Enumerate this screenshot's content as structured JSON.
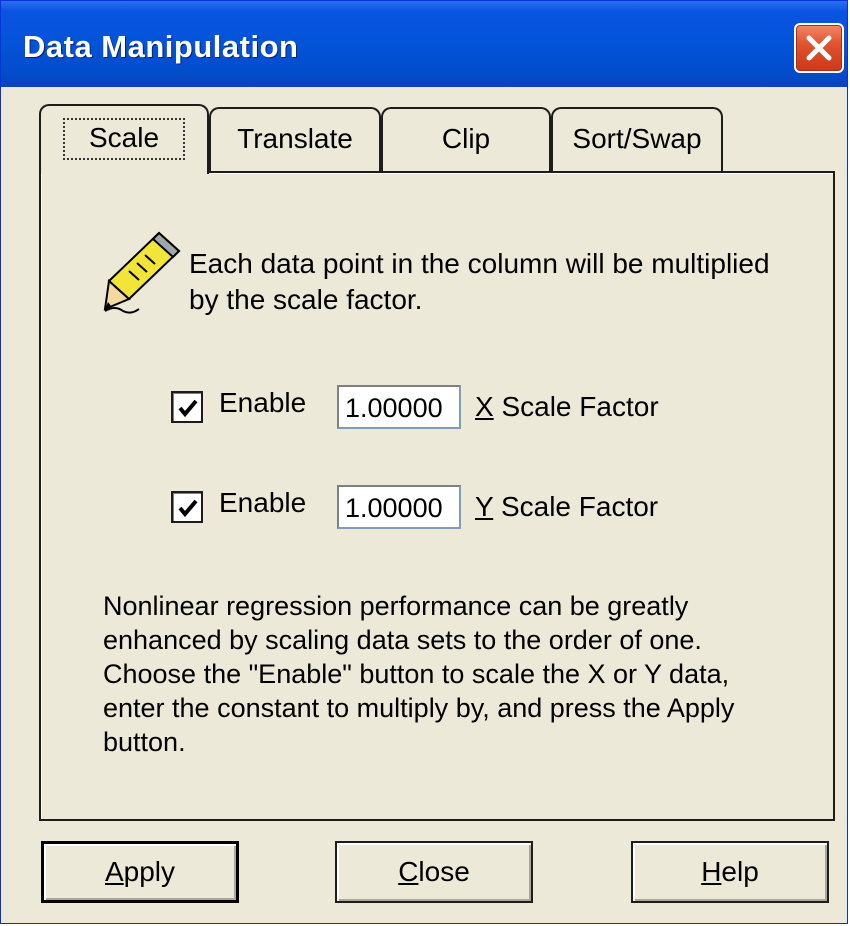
{
  "window": {
    "title": "Data Manipulation"
  },
  "tabs": [
    {
      "label": "Scale",
      "active": true
    },
    {
      "label": "Translate",
      "active": false
    },
    {
      "label": "Clip",
      "active": false
    },
    {
      "label": "Sort/Swap",
      "active": false
    }
  ],
  "scale": {
    "description_line1": "Each data point in the column will be multiplied",
    "description_line2": "by the scale factor.",
    "x": {
      "enabled": true,
      "enable_label": "Enable",
      "value": "1.00000",
      "mnemonic": "X",
      "label_rest": " Scale Factor"
    },
    "y": {
      "enabled": true,
      "enable_label": "Enable",
      "value": "1.00000",
      "mnemonic": "Y",
      "label_rest": " Scale Factor"
    },
    "note_lines": [
      "Nonlinear regression performance can be greatly",
      "enhanced by scaling data sets to the order of one.",
      "Choose the \"Enable\" button to scale the X or Y data,",
      "enter the constant to multiply by, and press the Apply",
      "button."
    ]
  },
  "buttons": {
    "apply": {
      "mnemonic": "A",
      "rest": "pply"
    },
    "close": {
      "mnemonic": "C",
      "rest": "lose"
    },
    "help": {
      "mnemonic": "H",
      "rest": "elp"
    }
  },
  "icons": {
    "close": "close-x-icon",
    "pencil": "pencil-icon",
    "check": "checkmark-icon"
  },
  "colors": {
    "titlebar": "#0354d8",
    "close_button": "#e2532f",
    "dialog_bg": "#ece9d8"
  }
}
